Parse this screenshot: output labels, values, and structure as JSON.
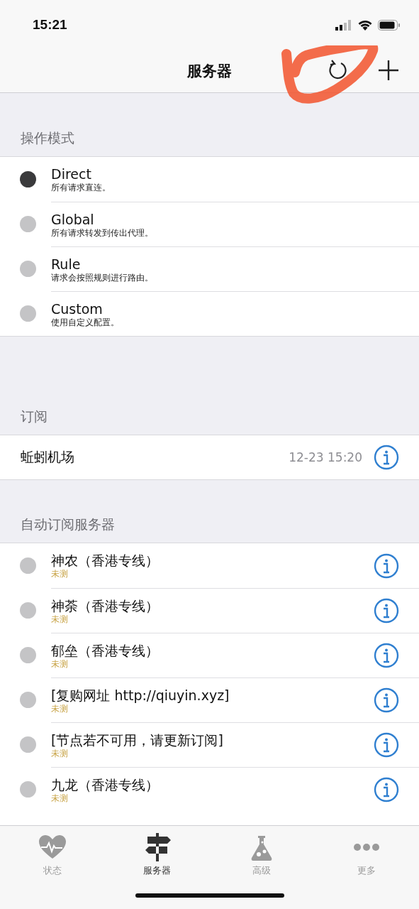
{
  "status_bar": {
    "time": "15:21"
  },
  "nav": {
    "title": "服务器"
  },
  "mode_section": {
    "header": "操作模式",
    "modes": [
      {
        "name": "Direct",
        "description": "所有请求直连。",
        "selected": true
      },
      {
        "name": "Global",
        "description": "所有请求转发到传出代理。",
        "selected": false
      },
      {
        "name": "Rule",
        "description": "请求会按照规则进行路由。",
        "selected": false
      },
      {
        "name": "Custom",
        "description": "使用自定义配置。",
        "selected": false
      }
    ]
  },
  "subscription_section": {
    "header": "订阅",
    "items": [
      {
        "name": "蚯蚓机场",
        "updated": "12-23 15:20"
      }
    ]
  },
  "servers_section": {
    "header": "自动订阅服务器",
    "servers": [
      {
        "name": "神农（香港专线）",
        "status": "未测",
        "selected": false
      },
      {
        "name": "神荼（香港专线）",
        "status": "未测",
        "selected": false
      },
      {
        "name": "郁垒（香港专线）",
        "status": "未测",
        "selected": false
      },
      {
        "name": "[复购网址 http://qiuyin.xyz]",
        "status": "未测",
        "selected": false
      },
      {
        "name": "[节点若不可用，请更新订阅]",
        "status": "未测",
        "selected": false
      },
      {
        "name": "九龙（香港专线）",
        "status": "未测",
        "selected": false
      }
    ]
  },
  "tab_bar": {
    "tabs": [
      {
        "kind": "heart",
        "label": "状态",
        "selected": false
      },
      {
        "kind": "signpost",
        "label": "服务器",
        "selected": true
      },
      {
        "kind": "flask",
        "label": "高级",
        "selected": false
      },
      {
        "kind": "more",
        "label": "更多",
        "selected": false
      }
    ]
  }
}
